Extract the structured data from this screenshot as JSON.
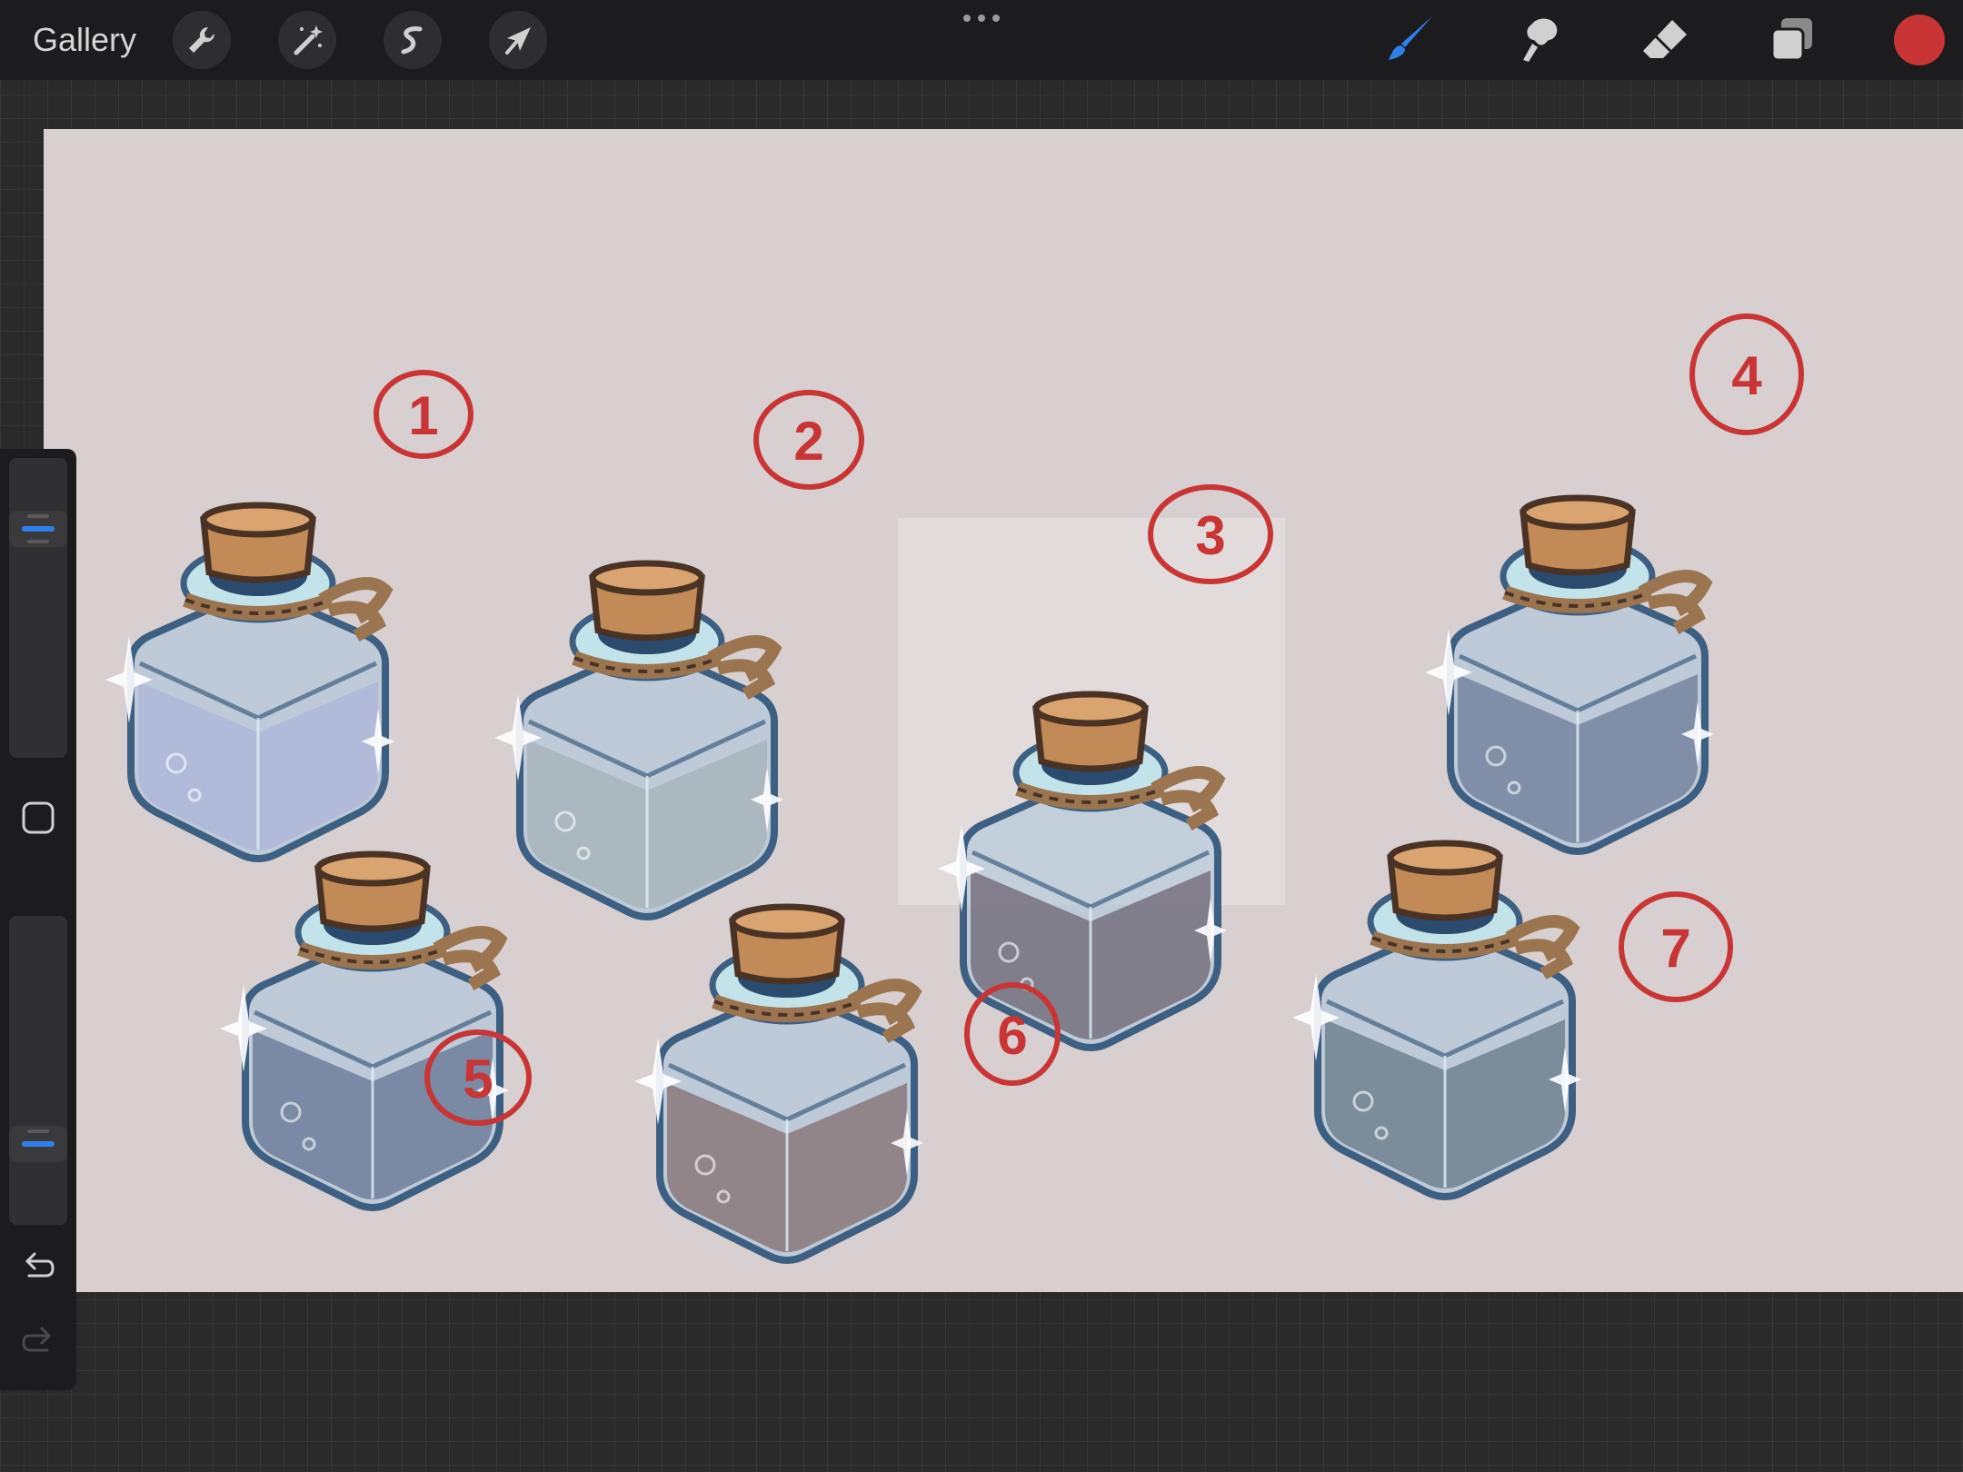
{
  "topbar": {
    "gallery_label": "Gallery",
    "tools_left": [
      "wrench-icon",
      "magic-wand-icon",
      "selection-icon",
      "transform-arrow-icon"
    ],
    "tools_right": [
      "brush-icon",
      "smudge-icon",
      "eraser-icon",
      "layers-icon"
    ],
    "active_tool": "brush",
    "accent_color": "#2f80ed",
    "current_color": "#c93434"
  },
  "canvas": {
    "background_color": "#d8cfd0",
    "annotation_color": "#c93434",
    "labels": [
      "1",
      "2",
      "3",
      "4",
      "5",
      "6",
      "7"
    ]
  },
  "sidebar": {
    "brush_size_level": 0.8,
    "opacity_level": 0.23,
    "items": [
      "brush-size-slider",
      "modify-button",
      "opacity-slider",
      "undo-button",
      "redo-button"
    ]
  }
}
